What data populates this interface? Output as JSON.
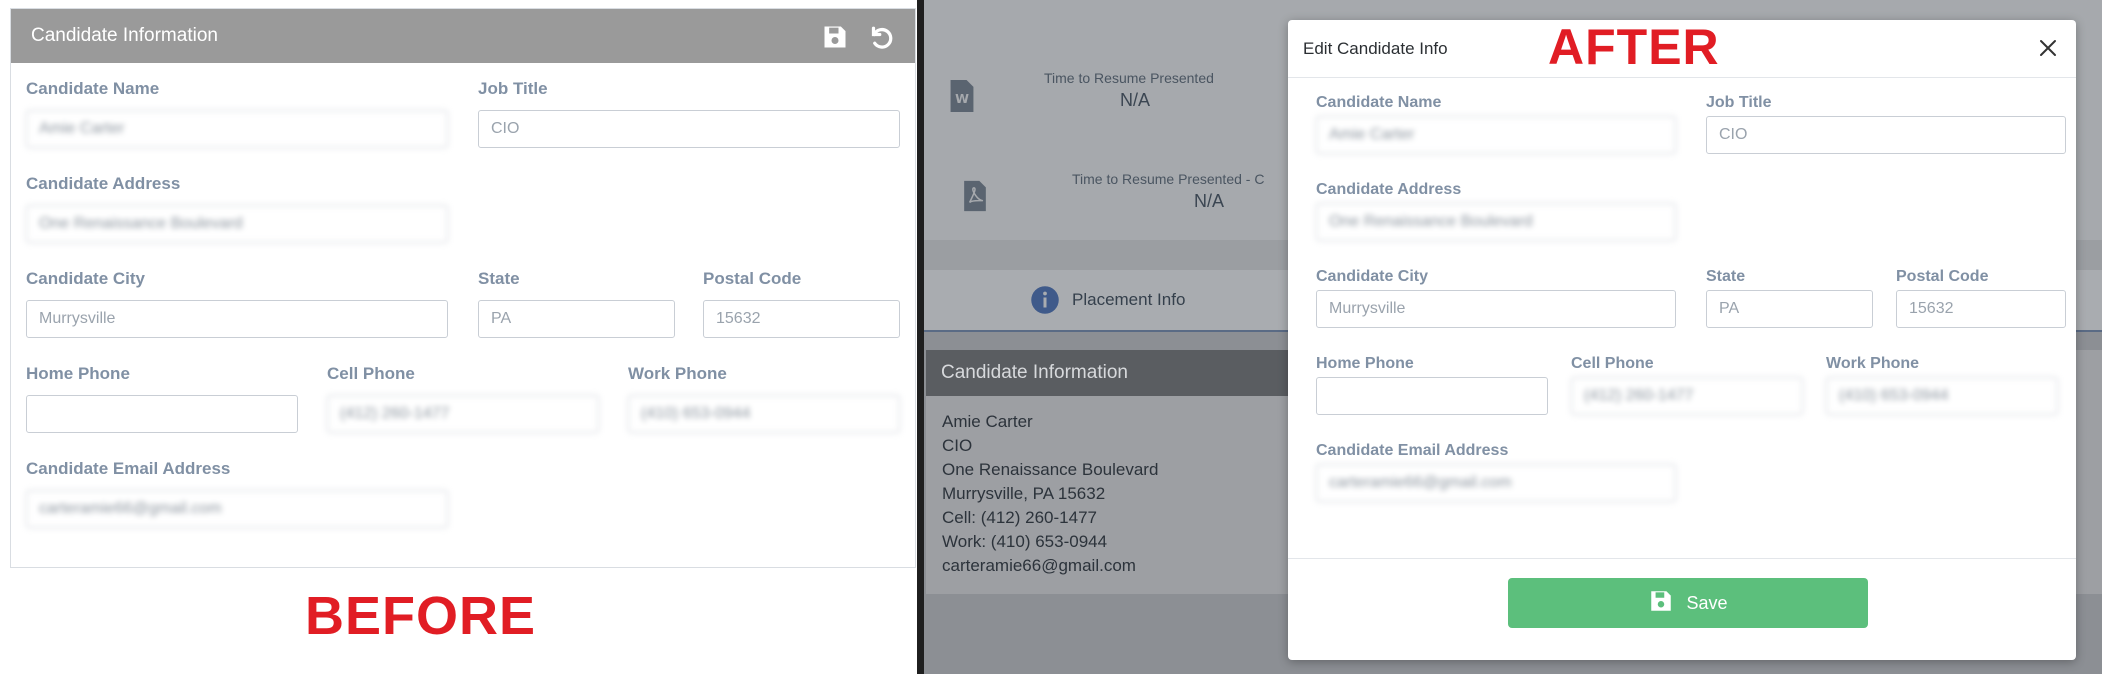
{
  "before": {
    "card_title": "Candidate Information",
    "annotation": "BEFORE",
    "fields": {
      "candidate_name": {
        "label": "Candidate Name",
        "value": "Amie Carter"
      },
      "job_title": {
        "label": "Job Title",
        "value": "CIO"
      },
      "candidate_address": {
        "label": "Candidate Address",
        "value": "One Renaissance Boulevard"
      },
      "candidate_city": {
        "label": "Candidate City",
        "value": "Murrysville"
      },
      "state": {
        "label": "State",
        "value": "PA"
      },
      "postal_code": {
        "label": "Postal Code",
        "value": "15632"
      },
      "home_phone": {
        "label": "Home Phone",
        "value": ""
      },
      "cell_phone": {
        "label": "Cell Phone",
        "value": "(412) 260-1477"
      },
      "work_phone": {
        "label": "Work Phone",
        "value": "(410) 653-0944"
      },
      "email": {
        "label": "Candidate Email Address",
        "value": "carteramie66@gmail.com"
      }
    }
  },
  "after": {
    "annotation": "AFTER",
    "background": {
      "metric1_label": "Time to Resume Presented",
      "metric1_value": "N/A",
      "metric2_label": "Time to Resume Presented - C",
      "metric2_value": "N/A",
      "tab_label": "Placement Info",
      "card_title": "Candidate Information",
      "lines": [
        "Amie Carter",
        "CIO",
        "One Renaissance Boulevard",
        "Murrysville, PA 15632",
        "Cell: (412) 260-1477",
        "Work: (410) 653-0944",
        "carteramie66@gmail.com"
      ]
    },
    "modal": {
      "title": "Edit Candidate Info",
      "save_label": "Save",
      "fields": {
        "candidate_name": {
          "label": "Candidate Name",
          "value": "Amie Carter"
        },
        "job_title": {
          "label": "Job Title",
          "value": "CIO"
        },
        "candidate_address": {
          "label": "Candidate Address",
          "value": "One Renaissance Boulevard"
        },
        "candidate_city": {
          "label": "Candidate City",
          "value": "Murrysville"
        },
        "state": {
          "label": "State",
          "value": "PA"
        },
        "postal_code": {
          "label": "Postal Code",
          "value": "15632"
        },
        "home_phone": {
          "label": "Home Phone",
          "value": ""
        },
        "cell_phone": {
          "label": "Cell Phone",
          "value": "(412) 260-1477"
        },
        "work_phone": {
          "label": "Work Phone",
          "value": "(410) 653-0944"
        },
        "email": {
          "label": "Candidate Email Address",
          "value": "carteramie66@gmail.com"
        }
      }
    }
  },
  "colors": {
    "annotation_red": "#e11d24",
    "header_gray": "#9a9a9a",
    "label_blue_gray": "#8090a4",
    "save_green": "#5cbf7c",
    "tab_icon_blue": "#3f5a8a"
  },
  "icons": [
    "save-icon",
    "undo-icon",
    "close-icon",
    "info-icon",
    "word-doc-icon",
    "pdf-icon"
  ]
}
